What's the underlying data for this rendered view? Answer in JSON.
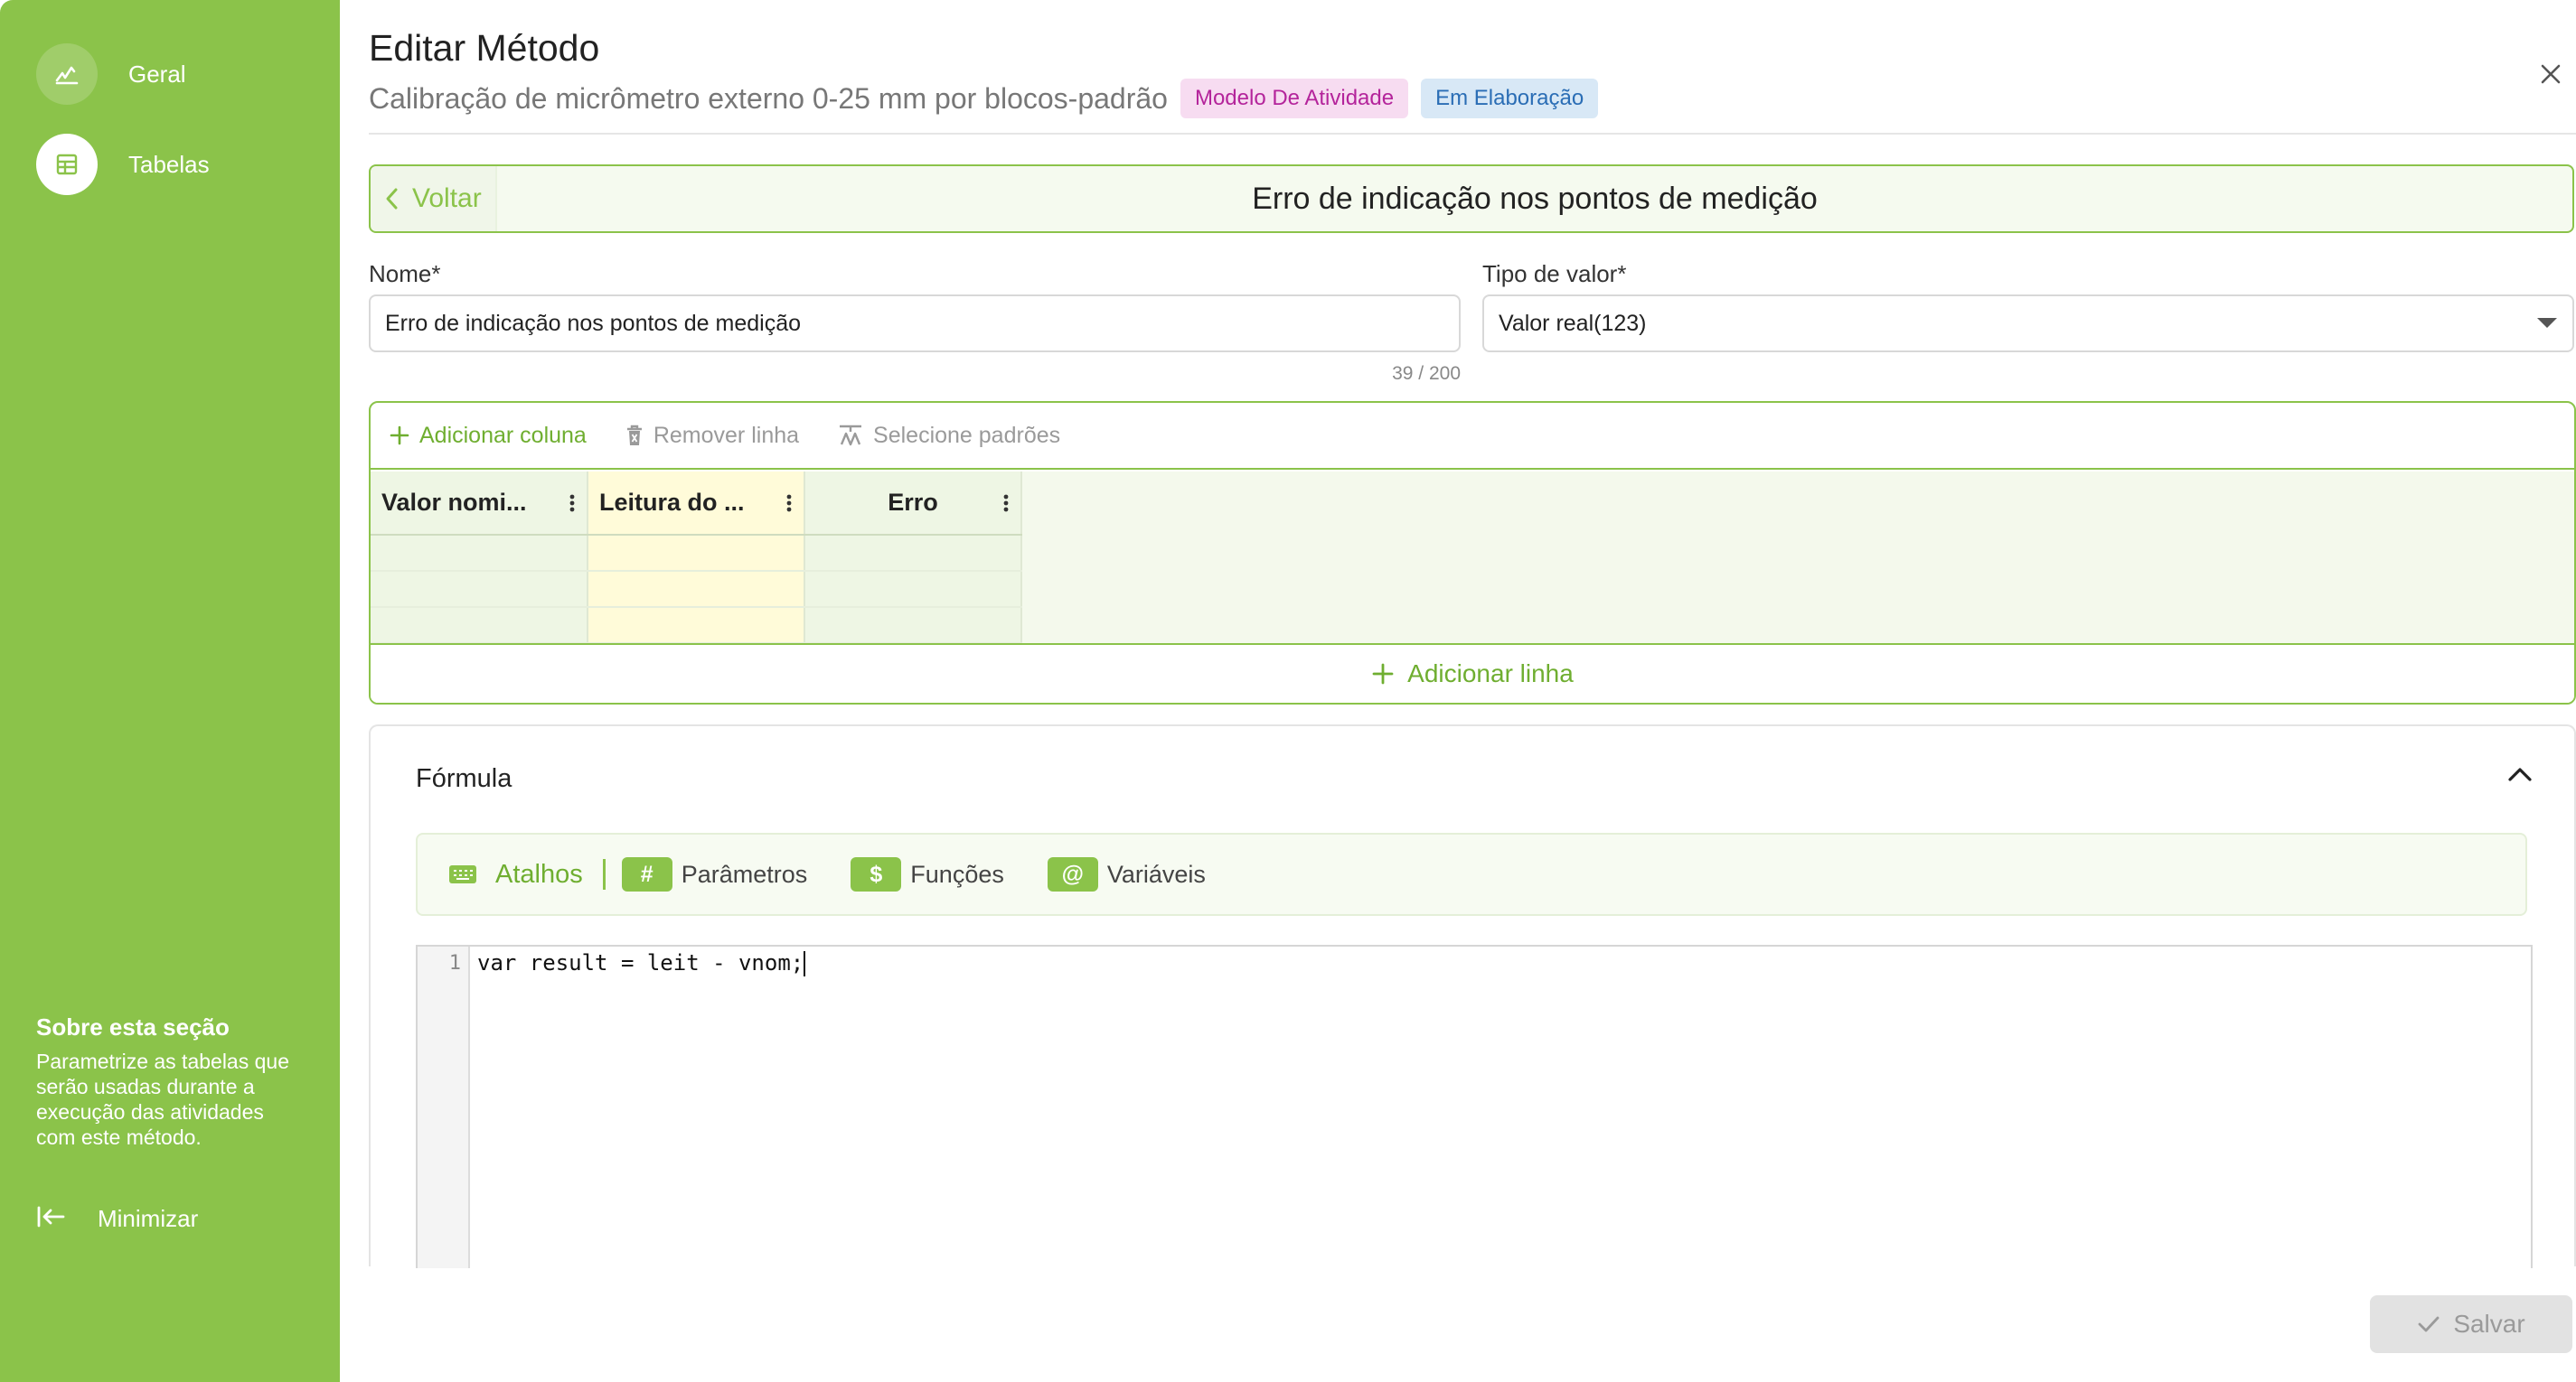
{
  "sidebar": {
    "items": [
      {
        "label": "Geral",
        "icon": "signature-icon"
      },
      {
        "label": "Tabelas",
        "icon": "table-icon"
      }
    ],
    "about": {
      "title": "Sobre esta seção",
      "text": "Parametrize as tabelas que serão usadas durante a execução das atividades com este método."
    },
    "minimize_label": "Minimizar"
  },
  "header": {
    "title": "Editar Método",
    "subtitle": "Calibração de micrômetro externo 0-25 mm por blocos-padrão",
    "badge_model": "Modelo De Atividade",
    "badge_status": "Em Elaboração"
  },
  "backbar": {
    "back_label": "Voltar",
    "title": "Erro de indicação nos pontos de medição"
  },
  "form": {
    "name_label": "Nome*",
    "name_value": "Erro de indicação nos pontos de medição",
    "name_counter": "39 / 200",
    "type_label": "Tipo de valor*",
    "type_value": "Valor real(123)"
  },
  "table_editor": {
    "toolbar": {
      "add_column": "Adicionar coluna",
      "remove_row": "Remover linha",
      "select_standards": "Selecione padrões"
    },
    "columns": [
      "Valor nomi...",
      "Leitura do ...",
      "Erro"
    ],
    "row_count": 3,
    "add_row_label": "Adicionar linha"
  },
  "formula": {
    "title": "Fórmula",
    "shortcuts": {
      "atalhos": "Atalhos",
      "parametros": "Parâmetros",
      "parametros_chip": "#",
      "funcoes": "Funções",
      "funcoes_chip": "$",
      "variaveis": "Variáveis",
      "variaveis_chip": "@"
    },
    "line_number": "1",
    "code": "var result = leit - vnom;"
  },
  "save_label": "Salvar",
  "colors": {
    "brand_green": "#8bc34a",
    "badge_model_bg": "#f7dcf1",
    "badge_model_text": "#b4249b",
    "badge_status_bg": "#d8e8f6",
    "badge_status_text": "#2a6db5"
  }
}
